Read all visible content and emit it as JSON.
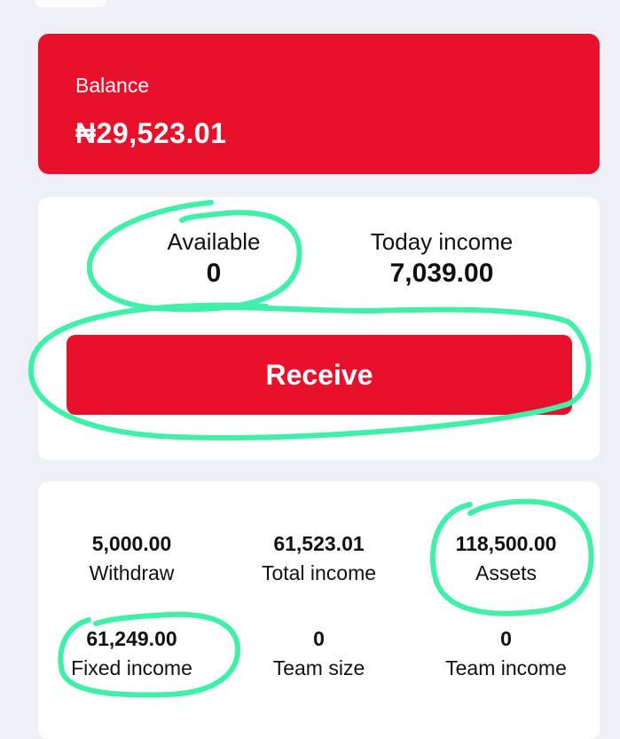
{
  "balance": {
    "label": "Balance",
    "value": "₦29,523.01"
  },
  "summary": {
    "available_label": "Available",
    "available_value": "0",
    "today_label": "Today income",
    "today_value": "7,039.00",
    "receive_label": "Receive"
  },
  "stats": [
    {
      "value": "5,000.00",
      "label": "Withdraw"
    },
    {
      "value": "61,523.01",
      "label": "Total income"
    },
    {
      "value": "118,500.00",
      "label": "Assets"
    },
    {
      "value": "61,249.00",
      "label": "Fixed income"
    },
    {
      "value": "0",
      "label": "Team size"
    },
    {
      "value": "0",
      "label": "Team income"
    }
  ],
  "colors": {
    "accent": "#e8102a",
    "annotation": "#3ff0a8",
    "background": "#eef0f6"
  }
}
